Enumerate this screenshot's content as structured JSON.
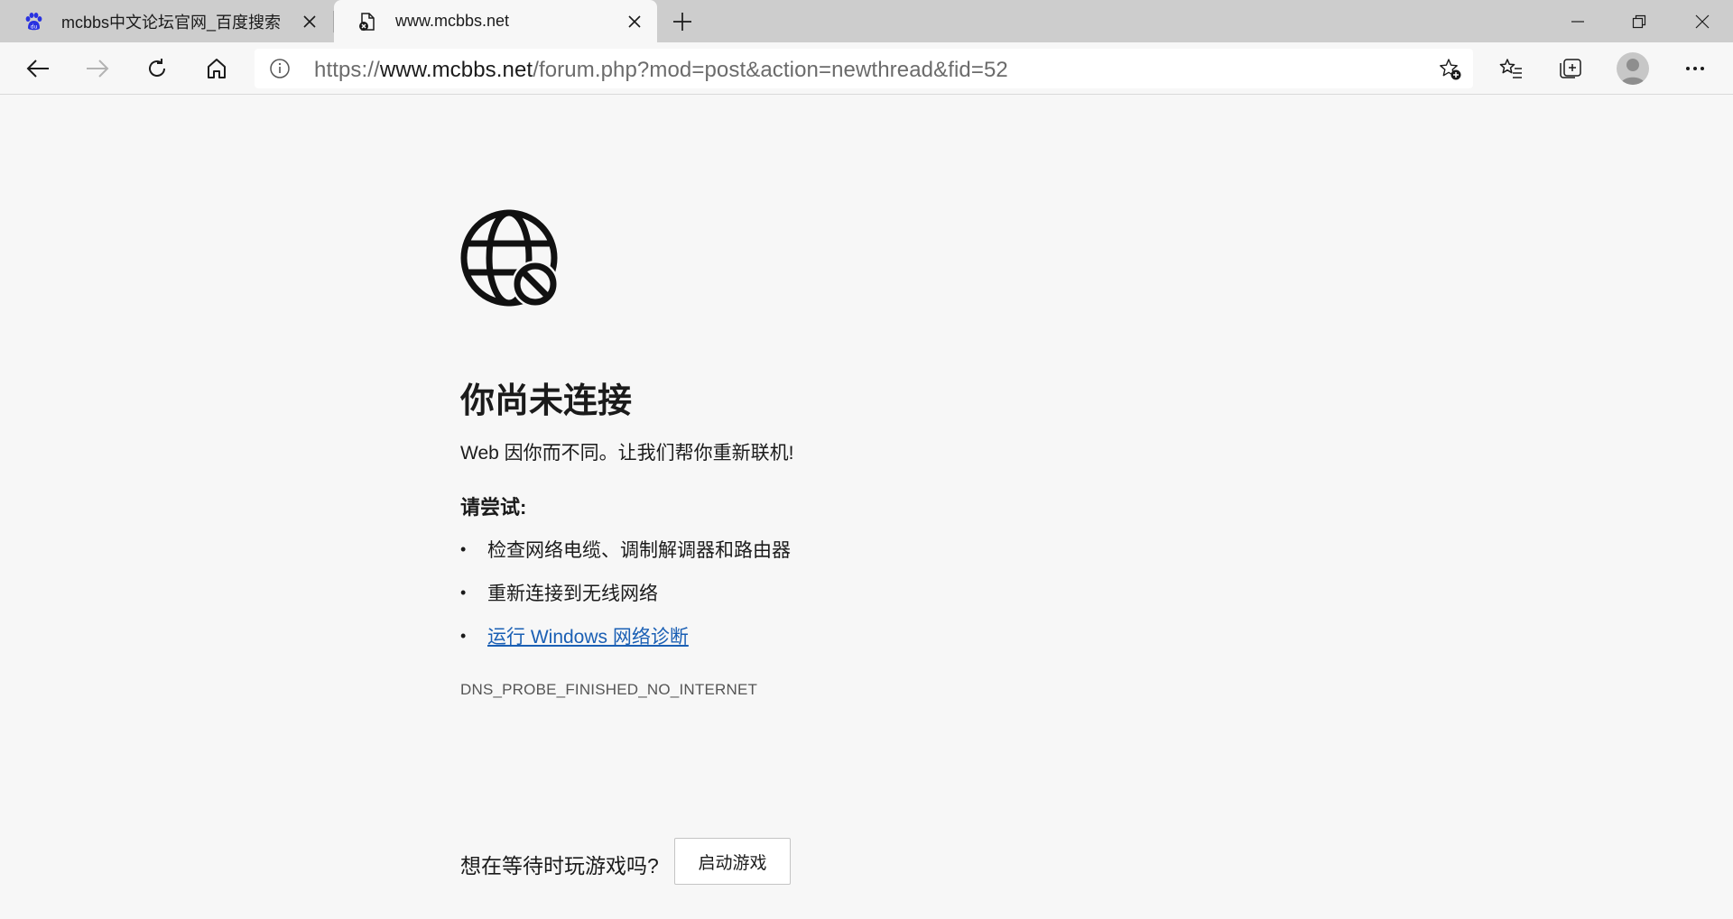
{
  "tabs": [
    {
      "title": "mcbbs中文论坛官网_百度搜索",
      "favicon": "baidu-paw-icon",
      "active": false
    },
    {
      "title": "www.mcbbs.net",
      "favicon": "page-error-icon",
      "active": true
    }
  ],
  "address": {
    "scheme": "https://",
    "host": "www.mcbbs.net",
    "path": "/forum.php?mod=post&action=newthread&fid=52"
  },
  "error": {
    "heading": "你尚未连接",
    "subtitle": "Web 因你而不同。让我们帮你重新联机!",
    "try_label": "请尝试:",
    "suggestions": [
      "检查网络电缆、调制解调器和路由器",
      "重新连接到无线网络"
    ],
    "link": "运行 Windows 网络诊断",
    "code": "DNS_PROBE_FINISHED_NO_INTERNET"
  },
  "game": {
    "prompt": "想在等待时玩游戏吗?",
    "button": "启动游戏"
  },
  "colors": {
    "tabstrip": "#cdcdcd",
    "page_bg": "#f7f7f7",
    "link": "#1a5fb4",
    "baidu_blue": "#2932e1"
  }
}
